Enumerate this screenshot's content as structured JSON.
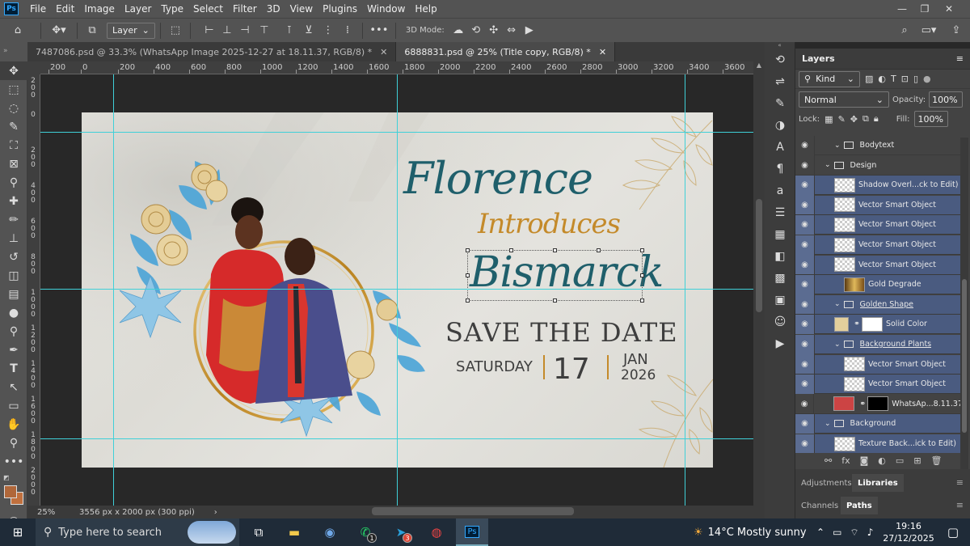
{
  "app": {
    "logo": "Ps",
    "menu": [
      "File",
      "Edit",
      "Image",
      "Layer",
      "Type",
      "Select",
      "Filter",
      "3D",
      "View",
      "Plugins",
      "Window",
      "Help"
    ]
  },
  "options_bar": {
    "layer_select": "Layer",
    "mode_label": "3D Mode:"
  },
  "tabs": [
    {
      "label": "7487086.psd @ 33.3% (WhatsApp Image 2025-12-27 at 18.11.37, RGB/8) *"
    },
    {
      "label": "6888831.psd @ 25% (Title copy, RGB/8) *"
    }
  ],
  "ruler_h": [
    "200",
    "0",
    "200",
    "400",
    "600",
    "800",
    "1000",
    "1200",
    "1400",
    "1600",
    "1800",
    "2000",
    "2200",
    "2400",
    "2600",
    "2800",
    "3000",
    "3200",
    "3400",
    "3600"
  ],
  "ruler_v": [
    "200",
    "0",
    "200",
    "400",
    "600",
    "800",
    "1000",
    "1200",
    "1400",
    "1600",
    "1800",
    "2000"
  ],
  "design": {
    "name1": "Florence",
    "verb": "Introduces",
    "name2": "Bismarck",
    "headline": "SAVE THE DATE",
    "day": "SATURDAY",
    "date": "17",
    "month": "JAN",
    "year": "2026",
    "accent_teal": "#1f5f6b",
    "accent_gold": "#c48a2a",
    "dark_text": "#3e3e3e"
  },
  "status": {
    "zoom": "25%",
    "doc_info": "3556 px x 2000 px (300 ppi)"
  },
  "layers_panel": {
    "title": "Layers",
    "filter_kind": "Kind",
    "blend_mode": "Normal",
    "opacity_label": "Opacity:",
    "opacity_value": "100%",
    "lock_label": "Lock:",
    "fill_label": "Fill:",
    "fill_value": "100%",
    "rows": [
      {
        "name": "Bodytext",
        "type": "folder",
        "indent": 2,
        "highlight": false
      },
      {
        "name": "Design",
        "type": "folder",
        "indent": 1,
        "highlight": false
      },
      {
        "name": "Shadow Overl...ck to Edit)",
        "type": "smart",
        "indent": 2,
        "highlight": true
      },
      {
        "name": "Vector Smart Object",
        "type": "smart",
        "indent": 2,
        "highlight": true
      },
      {
        "name": "Vector Smart Object",
        "type": "smart",
        "indent": 2,
        "highlight": true
      },
      {
        "name": "Vector Smart Object",
        "type": "smart",
        "indent": 2,
        "highlight": true
      },
      {
        "name": "Vector Smart Object",
        "type": "smart",
        "indent": 2,
        "highlight": true
      },
      {
        "name": "Gold Degrade",
        "type": "gradient",
        "indent": 3,
        "highlight": true
      },
      {
        "name": "Golden Shape",
        "type": "folder",
        "indent": 2,
        "highlight": true
      },
      {
        "name": "Solid Color",
        "type": "fill",
        "indent": 2,
        "highlight": true
      },
      {
        "name": "Background Plants",
        "type": "folder",
        "indent": 2,
        "highlight": true
      },
      {
        "name": "Vector Smart Object",
        "type": "smart",
        "indent": 3,
        "highlight": true
      },
      {
        "name": "Vector Smart Object",
        "type": "smart",
        "indent": 3,
        "highlight": true
      },
      {
        "name": "WhatsAp...8.11.37",
        "type": "photo",
        "indent": 2,
        "highlight": false
      },
      {
        "name": "Background",
        "type": "folder",
        "indent": 1,
        "highlight": true
      },
      {
        "name": "Texture Back...ick to Edit)",
        "type": "smart",
        "indent": 2,
        "highlight": true
      }
    ]
  },
  "bottom_tabs": {
    "adjustments": "Adjustments",
    "libraries": "Libraries",
    "channels": "Channels",
    "paths": "Paths"
  },
  "taskbar": {
    "search_placeholder": "Type here to search",
    "weather": "14°C  Mostly sunny",
    "time": "19:16",
    "date": "27/12/2025",
    "whatsapp_badge": "1",
    "telegram_badge": "3"
  }
}
